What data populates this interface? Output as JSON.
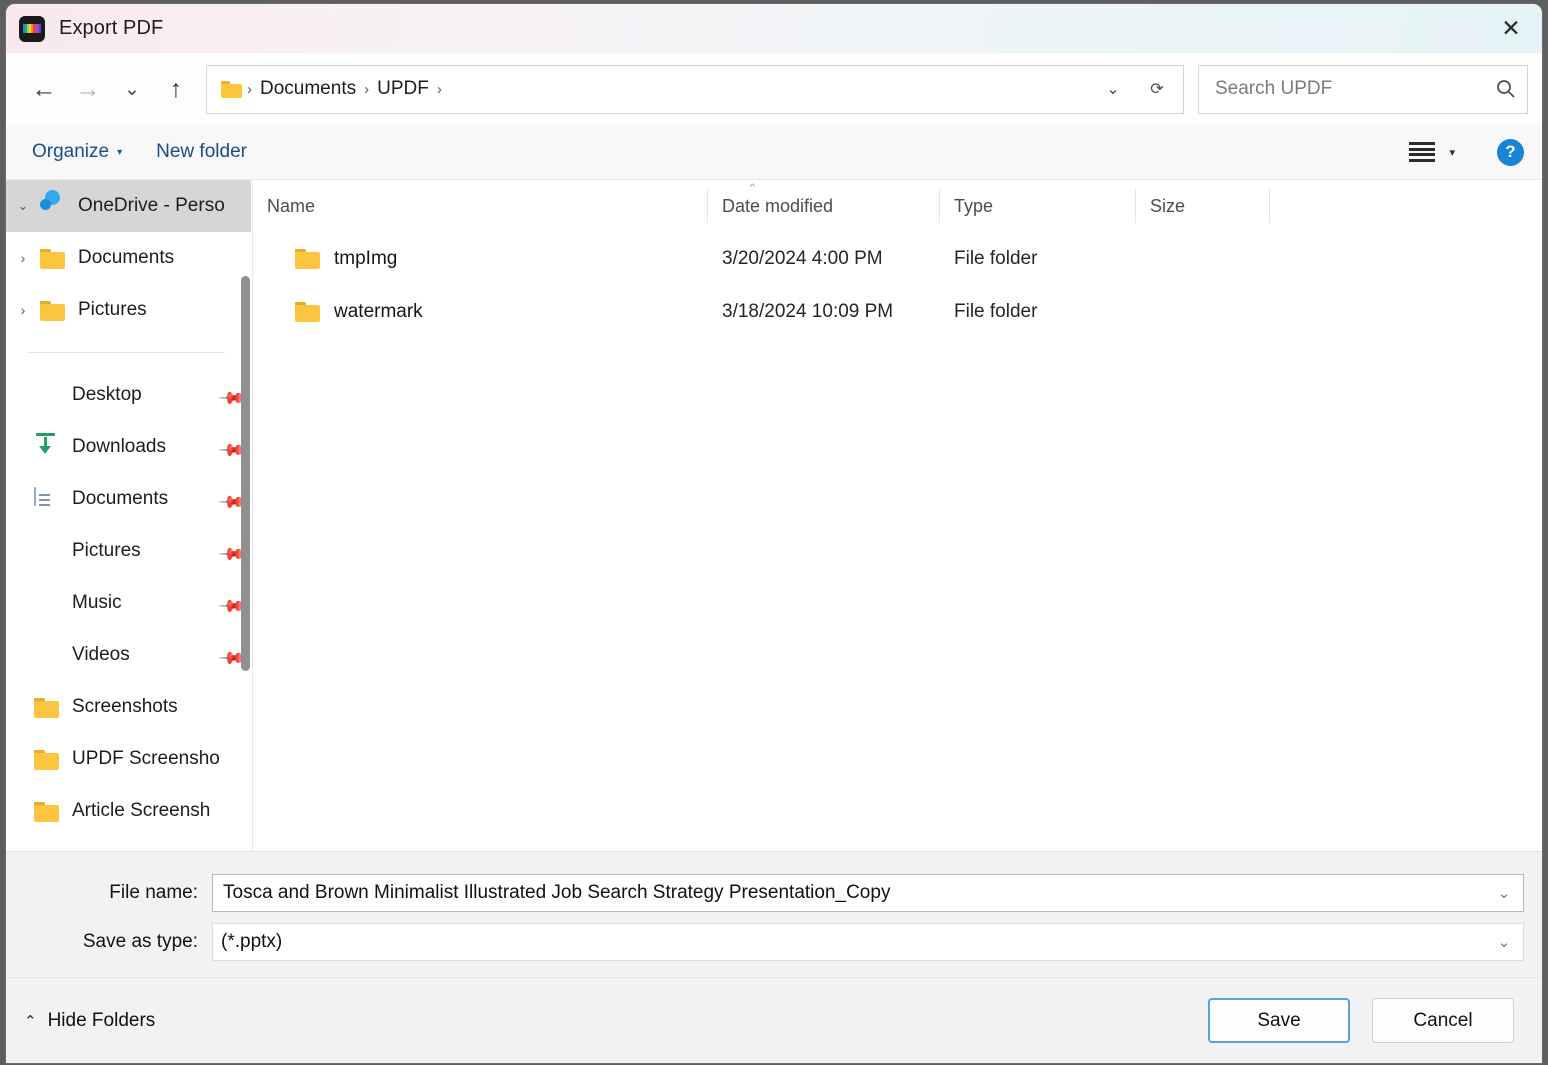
{
  "window": {
    "title": "Export PDF",
    "app_icon": "updf-app-icon",
    "close_label": "✕"
  },
  "nav": {
    "back": "←",
    "forward": "→",
    "recent": "⌄",
    "up": "↑",
    "dropdown": "⌄",
    "refresh": "⟳"
  },
  "address": {
    "folder_icon": "folder-icon",
    "crumbs": [
      "Documents",
      "UPDF"
    ],
    "separator": "›"
  },
  "search": {
    "placeholder": "Search UPDF",
    "value": "",
    "icon": "search-icon"
  },
  "commandbar": {
    "organize_label": "Organize",
    "organize_caret": "▾",
    "new_folder_label": "New folder",
    "view_icon": "view-list-icon",
    "view_caret": "▾",
    "help_label": "?"
  },
  "sidebar": {
    "items": [
      {
        "label": "OneDrive - Perso",
        "icon": "onedrive-cloud-icon",
        "chevron": "⌄",
        "selected": true,
        "indent": 0,
        "pinned": false
      },
      {
        "label": "Documents",
        "icon": "folder-icon",
        "chevron": "›",
        "selected": false,
        "indent": 1,
        "pinned": false
      },
      {
        "label": "Pictures",
        "icon": "folder-icon",
        "chevron": "›",
        "selected": false,
        "indent": 1,
        "pinned": false
      },
      {
        "label": "Desktop",
        "icon": "desktop-icon",
        "chevron": "",
        "selected": false,
        "indent": 1,
        "pinned": true
      },
      {
        "label": "Downloads",
        "icon": "downloads-icon",
        "chevron": "",
        "selected": false,
        "indent": 1,
        "pinned": true
      },
      {
        "label": "Documents",
        "icon": "documents-icon",
        "chevron": "",
        "selected": false,
        "indent": 1,
        "pinned": true
      },
      {
        "label": "Pictures",
        "icon": "pictures-icon",
        "chevron": "",
        "selected": false,
        "indent": 1,
        "pinned": true
      },
      {
        "label": "Music",
        "icon": "music-icon",
        "chevron": "",
        "selected": false,
        "indent": 1,
        "pinned": true
      },
      {
        "label": "Videos",
        "icon": "videos-icon",
        "chevron": "",
        "selected": false,
        "indent": 1,
        "pinned": true
      },
      {
        "label": "Screenshots",
        "icon": "folder-icon",
        "chevron": "",
        "selected": false,
        "indent": 1,
        "pinned": false
      },
      {
        "label": "UPDF Screensho",
        "icon": "folder-icon",
        "chevron": "",
        "selected": false,
        "indent": 1,
        "pinned": false
      },
      {
        "label": "Article Screensh",
        "icon": "folder-icon",
        "chevron": "",
        "selected": false,
        "indent": 1,
        "pinned": false
      }
    ],
    "pin_glyph": "📌"
  },
  "filelist": {
    "columns": [
      "Name",
      "Date modified",
      "Type",
      "Size"
    ],
    "sort_indicator": "⌃",
    "rows": [
      {
        "name": "tmpImg",
        "date": "3/20/2024 4:00 PM",
        "type": "File folder",
        "size": "",
        "icon": "folder-icon"
      },
      {
        "name": "watermark",
        "date": "3/18/2024 10:09 PM",
        "type": "File folder",
        "size": "",
        "icon": "folder-icon"
      }
    ]
  },
  "fields": {
    "file_name_label": "File name:",
    "file_name_value": "Tosca and Brown Minimalist Illustrated Job Search Strategy Presentation_Copy",
    "save_type_label": "Save as type:",
    "save_type_value": "(*.pptx)",
    "chevron": "⌄"
  },
  "footer": {
    "hide_folders_label": "Hide Folders",
    "hide_folders_caret": "⌃",
    "save_label": "Save",
    "cancel_label": "Cancel"
  },
  "colors": {
    "accent_blue": "#1a85d6",
    "focus_border": "#5aa0da",
    "link_blue": "#1a4d8f",
    "folder_yellow": "#fbc540",
    "selected_row": "#d6d6d6"
  }
}
